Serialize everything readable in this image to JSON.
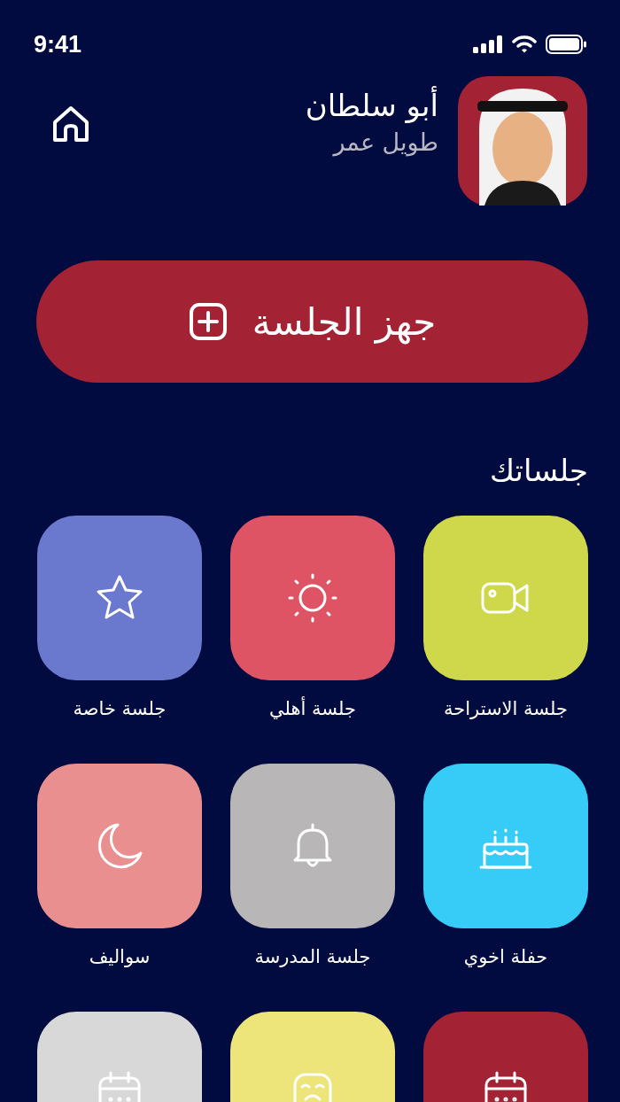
{
  "status_bar": {
    "time": "9:41"
  },
  "profile": {
    "name": "أبو سلطان",
    "subtitle": "طويل عمر"
  },
  "primary_button": {
    "label": "جهز الجلسة"
  },
  "section": {
    "title": "جلساتك"
  },
  "sessions": [
    {
      "label": "جلسة الاستراحة",
      "color": "#cfd74a"
    },
    {
      "label": "جلسة أهلي",
      "color": "#df5464"
    },
    {
      "label": "جلسة خاصة",
      "color": "#6a79ce"
    },
    {
      "label": "حفلة اخوي",
      "color": "#37ccf7"
    },
    {
      "label": "جلسة المدرسة",
      "color": "#b9b6b7"
    },
    {
      "label": "سواليف",
      "color": "#ea8f8f"
    },
    {
      "color": "#a32233"
    },
    {
      "color": "#ede47a"
    },
    {
      "color": "#d8d8d8"
    }
  ]
}
